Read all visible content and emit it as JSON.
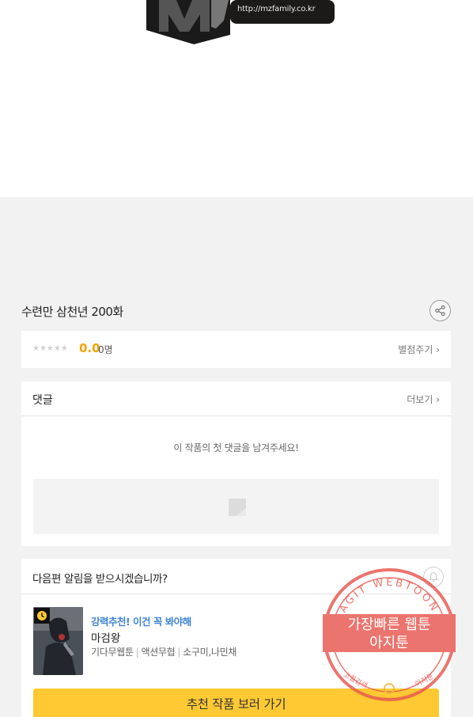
{
  "banner": {
    "url_text": "http://mzfamily.co.kr"
  },
  "episode": {
    "title": "수련만 삼천년 200화",
    "share_icon": "share-icon"
  },
  "rating": {
    "stars": "★★★★★",
    "score": "0.0",
    "count": "0명",
    "rate_link": "별점주기 ›"
  },
  "comments": {
    "title": "댓글",
    "more": "더보기 ›",
    "empty_message": "이 작품의 첫 댓글을 남겨주세요!"
  },
  "notify": {
    "question": "다음편 알림을 받으시겠습니까?",
    "bell_icon": "bell-icon"
  },
  "recommendation": {
    "tag": "강력추천! 이건 꼭 봐야해",
    "title": "마검왕",
    "genres": [
      "기다무웹툰",
      "액션무협"
    ],
    "authors": "소구미,나민채",
    "button": "추천 작품 보러 가기"
  },
  "watermark": {
    "ring_text": "AGIT WEBTOON",
    "line1": "가장빠른 웹툰",
    "line2": "아지툰",
    "bottom_left": "고퀄검색",
    "bottom_right": "아지툰"
  },
  "colors": {
    "accent_yellow": "#ffc933",
    "score_orange": "#f5a200",
    "tag_blue": "#3f84d6",
    "stamp_red": "#e8564f"
  }
}
